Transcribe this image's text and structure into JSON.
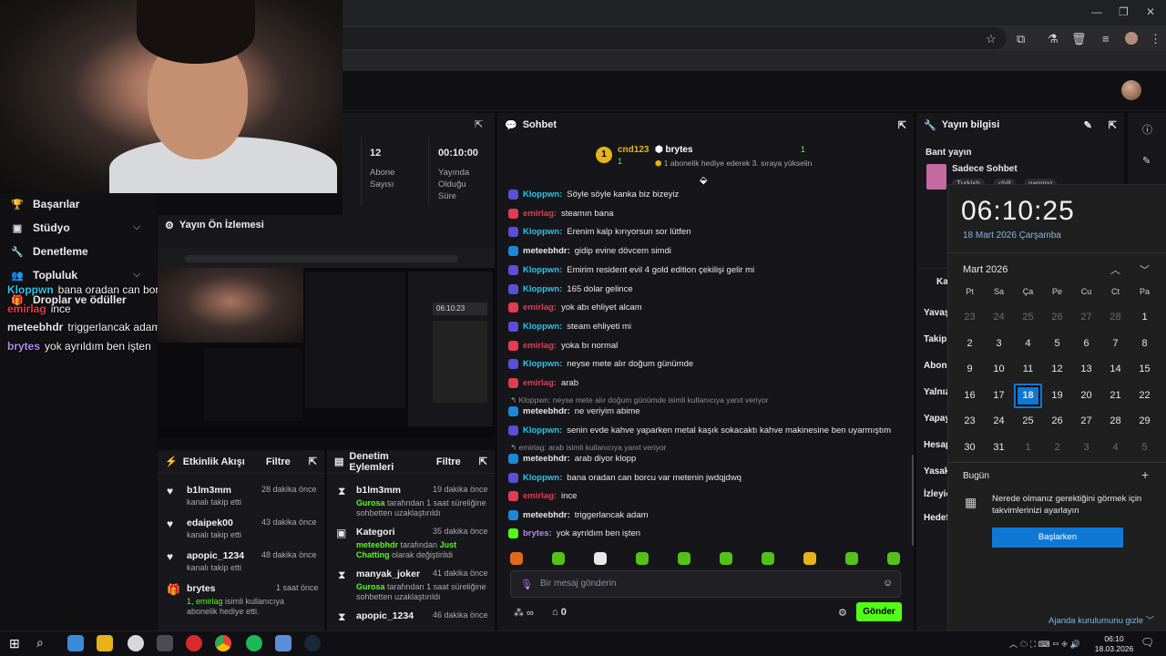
{
  "site": {
    "nav": [
      {
        "label": "Başarılar",
        "icon": "trophy-icon"
      },
      {
        "label": "Stüdyo",
        "icon": "camera-icon"
      },
      {
        "label": "Denetleme",
        "icon": "wrench-icon"
      },
      {
        "label": "Topluluk",
        "icon": "people-icon"
      },
      {
        "label": "Droplar ve ödüller",
        "icon": "gift-icon"
      }
    ]
  },
  "overlay_chat": [
    {
      "user": "Kloppwn",
      "text": "bana oradan can borcu var metenin jwdqjdwq",
      "color": "#2ec4e8"
    },
    {
      "user": "emirlag",
      "text": "ince",
      "color": "#e23c52"
    },
    {
      "user": "meteebhdr",
      "text": "triggerlancak adam",
      "color": "#e8e8e8"
    },
    {
      "user": "brytes",
      "text": "yok ayrıldım ben işten",
      "color": "#b587f4"
    }
  ],
  "stats": [
    {
      "value": "12",
      "label": "Abone Sayısı"
    },
    {
      "value": "00:10:00",
      "label": "Yayında Olduğu Süre"
    }
  ],
  "preview": {
    "title": "Yayın Ön İzlemesi",
    "clock": "06:10:23"
  },
  "activity": {
    "title": "Etkinlik Akışı",
    "filter": "Filtre",
    "items": [
      {
        "name": "b1lm3mm",
        "desc": "kanalı takip etti",
        "time": "28 dakika önce",
        "icon": "heart-icon"
      },
      {
        "name": "edaipek00",
        "desc": "kanalı takip etti",
        "time": "43 dakika önce",
        "icon": "heart-icon"
      },
      {
        "name": "apopic_1234",
        "desc": "kanalı takip etti",
        "time": "48 dakika önce",
        "icon": "heart-icon"
      },
      {
        "name": "brytes",
        "desc_hl": "1, emirlag",
        "desc": "isimli kullanıcıya abonelik hediye etti.",
        "time": "1 saat önce",
        "icon": "gift-icon"
      }
    ]
  },
  "moderation": {
    "title": "Denetim Eylemleri",
    "filter": "Filtre",
    "items": [
      {
        "name": "b1lm3mm",
        "time": "19 dakika önce",
        "hl": "Gurosa",
        "desc": "tarafından 1 saat süreliğine sohbetten uzaklaştırıldı",
        "icon": "hourglass-icon"
      },
      {
        "name": "Kategori",
        "time": "35 dakika önce",
        "hl": "meteebhdr",
        "desc": "tarafından",
        "hl2": "Just Chatting",
        "desc2": "olarak değiştirildi",
        "icon": "category-icon"
      },
      {
        "name": "manyak_joker",
        "time": "41 dakika önce",
        "hl": "Gurosa",
        "desc": "tarafından 1 saat süreliğine sohbetten uzaklaştırıldı",
        "icon": "hourglass-icon"
      },
      {
        "name": "apopic_1234",
        "time": "46 dakika önce",
        "icon": "hourglass-icon"
      }
    ]
  },
  "chat": {
    "title": "Sohbet",
    "pinned": {
      "rank": "1",
      "user1": "cnd123",
      "count1": "1",
      "user2": "brytes",
      "count2": "1",
      "sub_text": "1 abonelik hediye ederek 3. sıraya yükselin"
    },
    "messages": [
      {
        "user": "Kloppwn",
        "text": "Söyle söyle kanka biz bizeyiz",
        "color": "#2ec4e8",
        "badge": "#5b4fd8"
      },
      {
        "user": "emirlag",
        "text": "steamın bana",
        "color": "#e23c52",
        "badge": "#e23c52"
      },
      {
        "user": "Kloppwn",
        "text": "Erenim kalp kırıyorsun sor lütfen",
        "color": "#2ec4e8",
        "badge": "#5b4fd8"
      },
      {
        "user": "meteebhdr",
        "text": "gidip evine dövcem simdi",
        "color": "#e8e8e8",
        "badge": "#1e88d8"
      },
      {
        "user": "Kloppwn",
        "text": "Emirim resident evil 4 gold edition çekilişi gelir mi",
        "color": "#2ec4e8",
        "badge": "#5b4fd8"
      },
      {
        "user": "Kloppwn",
        "text": "165 dolar gelince",
        "color": "#2ec4e8",
        "badge": "#5b4fd8"
      },
      {
        "user": "emirlag",
        "text": "yok abı ehliyet alcam",
        "color": "#e23c52",
        "badge": "#e23c52"
      },
      {
        "user": "Kloppwn",
        "text": "steam ehliyeti mi",
        "color": "#2ec4e8",
        "badge": "#5b4fd8"
      },
      {
        "user": "emirlag",
        "text": "yoka bı normal",
        "color": "#e23c52",
        "badge": "#e23c52"
      },
      {
        "user": "Kloppwn",
        "text": "neyse mete alır doğum günümde",
        "color": "#2ec4e8",
        "badge": "#5b4fd8"
      },
      {
        "user": "emirlag",
        "text": "arab",
        "color": "#e23c52",
        "badge": "#e23c52"
      }
    ],
    "reply1": "Kloppwn: neyse mete alır doğum günümde isimli kullanıcıya yanıt veriyor",
    "messages2": [
      {
        "user": "meteebhdr",
        "text": "ne veriyim abime",
        "color": "#e8e8e8",
        "badge": "#1e88d8"
      },
      {
        "user": "Kloppwn",
        "text": "senin evde kahve yaparken metal kaşık sokacaktı kahve makinesine ben uyarmıştım",
        "color": "#2ec4e8",
        "badge": "#5b4fd8"
      }
    ],
    "reply2": "emirlag: arab isimli kullanıcıya yanıt veriyor",
    "messages3": [
      {
        "user": "meteebhdr",
        "text": "arab diyor klopp",
        "color": "#e8e8e8",
        "badge": "#1e88d8"
      },
      {
        "user": "Kloppwn",
        "text": "bana oradan can borcu var metenin jwdqjdwq",
        "color": "#2ec4e8",
        "badge": "#5b4fd8"
      },
      {
        "user": "emirlag",
        "text": "ince",
        "color": "#e23c52",
        "badge": "#e23c52"
      },
      {
        "user": "meteebhdr",
        "text": "triggerlancak adam",
        "color": "#e8e8e8",
        "badge": "#1e88d8"
      },
      {
        "user": "brytes",
        "text": "yok ayrıldım ben işten",
        "color": "#b587f4",
        "badge": "#53fc18"
      }
    ],
    "input_placeholder": "Bir mesaj gönderin",
    "points": "0",
    "send": "Gönder"
  },
  "info": {
    "title": "Yayın bilgisi",
    "section": "Bant yayın",
    "stream_title": "Sadece Sohbet",
    "tags": [
      "Turkish",
      "chill",
      "gaming"
    ],
    "labels": [
      "Kan",
      "Yavaş",
      "Takip",
      "Abone",
      "Yalnız",
      "Yapay",
      "Hesap",
      "Yasak",
      "İzleyic",
      "Hedef"
    ]
  },
  "calendar": {
    "time": "06:10:25",
    "date": "18 Mart 2026 Çarşamba",
    "month": "Mart 2026",
    "dow": [
      "Pt",
      "Sa",
      "Ça",
      "Pe",
      "Cu",
      "Ct",
      "Pa"
    ],
    "weeks": [
      [
        [
          "23",
          1
        ],
        [
          "24",
          1
        ],
        [
          "25",
          1
        ],
        [
          "26",
          1
        ],
        [
          "27",
          1
        ],
        [
          "28",
          1
        ],
        [
          "1",
          0
        ]
      ],
      [
        [
          "2",
          0
        ],
        [
          "3",
          0
        ],
        [
          "4",
          0
        ],
        [
          "5",
          0
        ],
        [
          "6",
          0
        ],
        [
          "7",
          0
        ],
        [
          "8",
          0
        ]
      ],
      [
        [
          "9",
          0
        ],
        [
          "10",
          0
        ],
        [
          "11",
          0
        ],
        [
          "12",
          0
        ],
        [
          "13",
          0
        ],
        [
          "14",
          0
        ],
        [
          "15",
          0
        ]
      ],
      [
        [
          "16",
          0
        ],
        [
          "17",
          0
        ],
        [
          "18",
          2
        ],
        [
          "19",
          0
        ],
        [
          "20",
          0
        ],
        [
          "21",
          0
        ],
        [
          "22",
          0
        ]
      ],
      [
        [
          "23",
          0
        ],
        [
          "24",
          0
        ],
        [
          "25",
          0
        ],
        [
          "26",
          0
        ],
        [
          "27",
          0
        ],
        [
          "28",
          0
        ],
        [
          "29",
          0
        ]
      ],
      [
        [
          "30",
          0
        ],
        [
          "31",
          0
        ],
        [
          "1",
          1
        ],
        [
          "2",
          1
        ],
        [
          "3",
          1
        ],
        [
          "4",
          1
        ],
        [
          "5",
          1
        ]
      ]
    ],
    "today": "Bugün",
    "hint": "Nerede olmanız gerektiğini görmek için takvimlerinizi ayarlayın",
    "start": "Başlarken",
    "hide": "Ajanda kurulumunu gizle"
  },
  "taskbar": {
    "time": "06:10",
    "date": "18.03.2026"
  },
  "colors": {
    "accent": "#53fc18",
    "win_blue": "#0f78d4"
  }
}
